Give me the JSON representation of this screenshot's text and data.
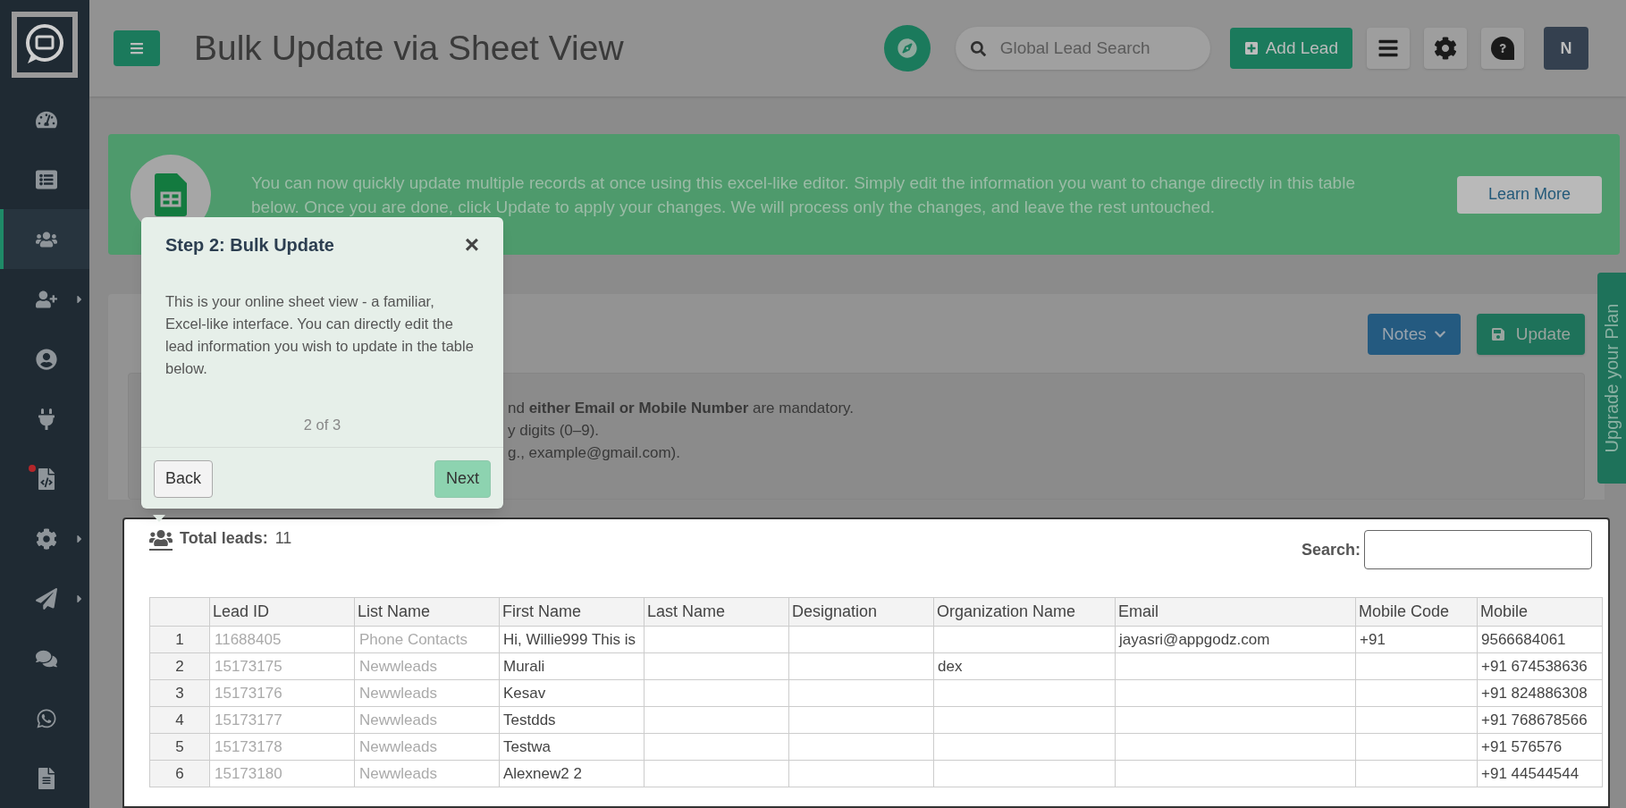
{
  "sidebar": {
    "items": [
      {
        "selected": false,
        "has_submenu": false,
        "badge": false
      },
      {
        "selected": false,
        "has_submenu": false,
        "badge": false
      },
      {
        "selected": true,
        "has_submenu": false,
        "badge": false
      },
      {
        "selected": false,
        "has_submenu": true,
        "badge": false
      },
      {
        "selected": false,
        "has_submenu": false,
        "badge": false
      },
      {
        "selected": false,
        "has_submenu": false,
        "badge": false
      },
      {
        "selected": false,
        "has_submenu": false,
        "badge": true
      },
      {
        "selected": false,
        "has_submenu": true,
        "badge": false
      },
      {
        "selected": false,
        "has_submenu": true,
        "badge": false
      },
      {
        "selected": false,
        "has_submenu": false,
        "badge": false
      },
      {
        "selected": false,
        "has_submenu": false,
        "badge": false
      },
      {
        "selected": false,
        "has_submenu": false,
        "badge": false
      }
    ]
  },
  "header": {
    "title": "Bulk Update via Sheet View",
    "search_placeholder": "Global Lead Search",
    "add_button": "Add Lead",
    "avatar": "N"
  },
  "banner": {
    "text": "You can now quickly update multiple records at once using this excel-like editor. Simply edit the information you want to change directly in this table below. Once you are done, click Update to apply your changes. We will process only the changes, and leave the rest untouched.",
    "button": "Learn More"
  },
  "toolbar": {
    "notes_button": "Notes",
    "update_button": "Update"
  },
  "notes": [
    "nd **either Email or Mobile Number** are mandatory.",
    "y digits (0–9).",
    "g., example@gmail.com)."
  ],
  "upgrade_tab": "Upgrade your Plan",
  "tour": {
    "title": "Step 2: Bulk Update",
    "close": "×",
    "body": "This is your online sheet view - a familiar, Excel-like interface. You can directly edit the lead information you wish to update in the table below.",
    "progress": "2 of 3",
    "back": "Back",
    "next": "Next"
  },
  "summary": {
    "label": "Total leads:",
    "value": "11"
  },
  "search_label": "Search:",
  "table": {
    "columns": [
      "",
      "Lead ID",
      "List Name",
      "First Name",
      "Last Name",
      "Designation",
      "Organization Name",
      "Email",
      "Mobile Code",
      "Mobile"
    ],
    "rows": [
      [
        "1",
        "11688405",
        "Phone Contacts",
        "Hi, Willie999 This is",
        "",
        "",
        "",
        "jayasri@appgodz.com",
        "+91",
        "9566684061"
      ],
      [
        "2",
        "15173175",
        "Newwleads",
        "Murali",
        "",
        "",
        "dex",
        "",
        "",
        "+91 674538636"
      ],
      [
        "3",
        "15173176",
        "Newwleads",
        "Kesav",
        "",
        "",
        "",
        "",
        "",
        "+91 824886308"
      ],
      [
        "4",
        "15173177",
        "Newwleads",
        "Testdds",
        "",
        "",
        "",
        "",
        "",
        "+91 768678566"
      ],
      [
        "5",
        "15173178",
        "Newwleads",
        "Testwa",
        "",
        "",
        "",
        "",
        "",
        "+91 576576"
      ],
      [
        "6",
        "15173180",
        "Newwleads",
        "Alexnew2 2",
        "",
        "",
        "",
        "",
        "",
        "+91 44544544"
      ]
    ]
  }
}
